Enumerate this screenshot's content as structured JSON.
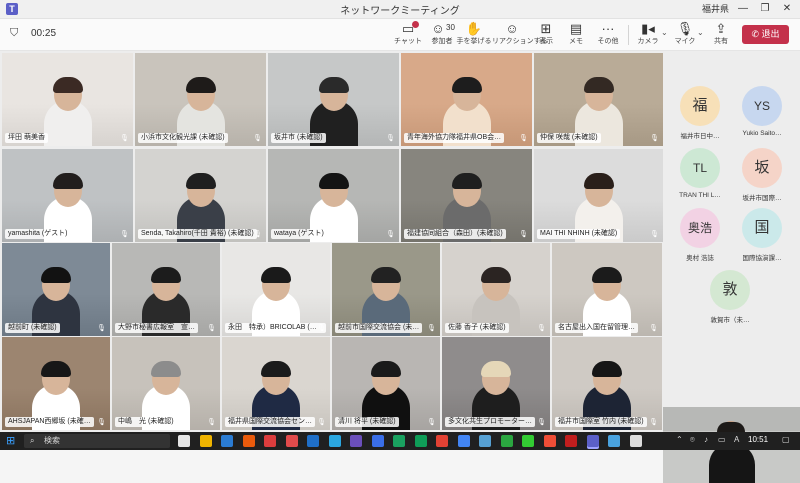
{
  "window": {
    "title": "ネットワークミーティング",
    "user": "福井県",
    "minimize": "—",
    "restore": "❐",
    "close": "✕"
  },
  "meeting": {
    "timer": "00:25",
    "participant_count": "30"
  },
  "toolbar": {
    "chat": "チャット",
    "people": "参加者",
    "raise_hand": "手を挙げる",
    "reactions": "リアクションする",
    "view": "表示",
    "notes": "メモ",
    "more": "その他",
    "camera": "カメラ",
    "mic": "マイク",
    "share": "共有",
    "leave": "退出"
  },
  "tiles": [
    {
      "name": "坪田 萌美香",
      "colors": [
        "#e9e5e1",
        "#3b2a24",
        "#f0efee"
      ]
    },
    {
      "name": "小浜市文化観光課 (未確認)",
      "colors": [
        "#c9c4bc",
        "#1e1b19",
        "#e4e4e0"
      ]
    },
    {
      "name": "坂井市 (未確認)",
      "colors": [
        "#c6c8c8",
        "#2a2a2a",
        "#202020"
      ]
    },
    {
      "name": "青年海外協力隊福井県OB会…",
      "colors": [
        "#d8a989",
        "#1d1d1d",
        "#f2e0cc"
      ]
    },
    {
      "name": "仲保 咲哉 (未確認)",
      "colors": [
        "#b9ab97",
        "#332923",
        "#ece7de"
      ]
    },
    {
      "name": "yamashita (ゲスト)",
      "colors": [
        "#bfc2c4",
        "#221e1d",
        "#ffffff"
      ]
    },
    {
      "name": "Senda, Takahiro(千田 貴裕) (未確認)",
      "colors": [
        "#d4d3d0",
        "#1f1f1f",
        "#3a3f48"
      ]
    },
    {
      "name": "wataya (ゲスト)",
      "colors": [
        "#b6b7b5",
        "#141414",
        "#ffffff"
      ]
    },
    {
      "name": "福建協同組合（森田）(未確認)",
      "colors": [
        "#87857e",
        "#1f1f1f",
        "#6b6b6b"
      ]
    },
    {
      "name": "MAI THI NHINH (未確認)",
      "colors": [
        "#dcdcdc",
        "#2a1f1a",
        "#f3f0ec"
      ]
    },
    {
      "name": "越前町 (未確認)",
      "colors": [
        "#7e8a96",
        "#121212",
        "#2e3440"
      ]
    },
    {
      "name": "大野市秘書広報室　宣…",
      "colors": [
        "#b8b8b6",
        "#1c1c1c",
        "#2a2a2a"
      ]
    },
    {
      "name": "永田　特承）BRICOLAB (未…",
      "colors": [
        "#e8e7e5",
        "#1a1a1a",
        "#ffffff"
      ]
    },
    {
      "name": "越前市国際交流協会 (未…",
      "colors": [
        "#9a9889",
        "#222222",
        "#5a6a7a"
      ]
    },
    {
      "name": "佐藤 香子 (未確認)",
      "colors": [
        "#d6d2cd",
        "#2b2422",
        "#c7c3be"
      ]
    },
    {
      "name": "名古屋出入国在留管理…",
      "colors": [
        "#cdc8c1",
        "#1b1b1b",
        "#ffffff"
      ]
    },
    {
      "name": "AHSJAPAN西郷坂 (未確…",
      "colors": [
        "#9c8570",
        "#171717",
        "#ffffff"
      ]
    },
    {
      "name": "中嶋　光 (未確認)",
      "colors": [
        "#c7c2bb",
        "#8c8c8c",
        "#ffffff"
      ]
    },
    {
      "name": "福井県国際交流協会セン…",
      "colors": [
        "#dad6d0",
        "#1b1b1b",
        "#1f2a44"
      ]
    },
    {
      "name": "清川 将平 (未確認)",
      "colors": [
        "#b9b6b3",
        "#1a1a1a",
        "#101010"
      ]
    },
    {
      "name": "多文化共生プロモーター…",
      "colors": [
        "#8f8c8c",
        "#e5d7b8",
        "#1e1e1e"
      ]
    },
    {
      "name": "福井市国際室 竹内 (未確認)",
      "colors": [
        "#cfcac4",
        "#161616",
        "#1d2434"
      ]
    }
  ],
  "roster": [
    {
      "initials": "福",
      "name": "福井市日中…",
      "color": "#f7e0b8"
    },
    {
      "initials": "YS",
      "name": "Yukio Saito…",
      "color": "#c7d7ef"
    },
    {
      "initials": "TL",
      "name": "TRAN THI L…",
      "color": "#cde8d4"
    },
    {
      "initials": "坂",
      "name": "坂井市国際…",
      "color": "#f5d4c8"
    },
    {
      "initials": "奥浩",
      "name": "奥村 浩誌",
      "color": "#f2d2e4"
    },
    {
      "initials": "国",
      "name": "国際協演課…",
      "color": "#cbe9ea"
    },
    {
      "initials": "敦",
      "name": "敦賀市（未…",
      "color": "#d4e8d2"
    }
  ],
  "taskbar": {
    "search_label": "検索",
    "time": "10:51",
    "ime": "A"
  }
}
